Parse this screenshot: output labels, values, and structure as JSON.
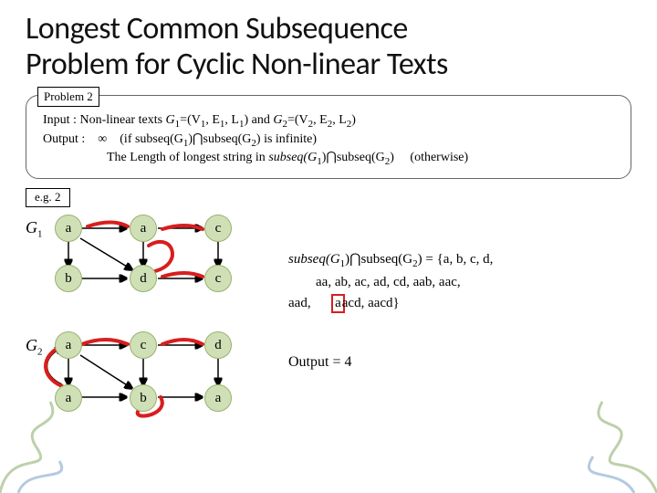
{
  "title_line1": "Longest Common Subsequence",
  "title_line2": "Problem for Cyclic Non-linear Texts",
  "problem": {
    "tag": "Problem 2",
    "input_label": "Input :",
    "input_text": "Non-linear texts ",
    "g1": "G",
    "g1sub": "1",
    "eq1": "=(V",
    "v1sub": "1",
    "e1": ", E",
    "e1sub": "1",
    "l1": ", L",
    "l1sub": "1",
    "and": ") and ",
    "g2": "G",
    "g2sub": "2",
    "eq2": "=(V",
    "v2sub": "2",
    "e2": ", E",
    "e2sub": "2",
    "l2": ", L",
    "l2sub": "2",
    "close2": ")",
    "output_label": "Output :",
    "inf": "∞",
    "inf_cond": "(if subseq(G",
    "inf_mid": ")⋂subseq(G",
    "inf_end": ") is infinite)",
    "len_text": "The Length of longest string in ",
    "subseq": "subseq(G",
    "cap": ")⋂subseq(G",
    "closep": ")",
    "otherwise": "(otherwise)"
  },
  "eg_label": "e.g. 2",
  "g1_label": "G",
  "g1_label_sub": "1",
  "g2_label": "G",
  "g2_label_sub": "2",
  "nodes_g1": [
    "a",
    "a",
    "c",
    "b",
    "d",
    "c"
  ],
  "nodes_g2": [
    "a",
    "c",
    "d",
    "a",
    "b",
    "a"
  ],
  "result": {
    "lhs1": "subseq(G",
    "lhs2": ")⋂subseq(G",
    "rhs": ") = {a, b, c, d,",
    "line2": "aa, ab, ac, ad, cd, aab, aac,",
    "line3a": "aad,",
    "line3b": "acd, aacd}",
    "hl1": "a",
    "output": "Output = 4"
  }
}
